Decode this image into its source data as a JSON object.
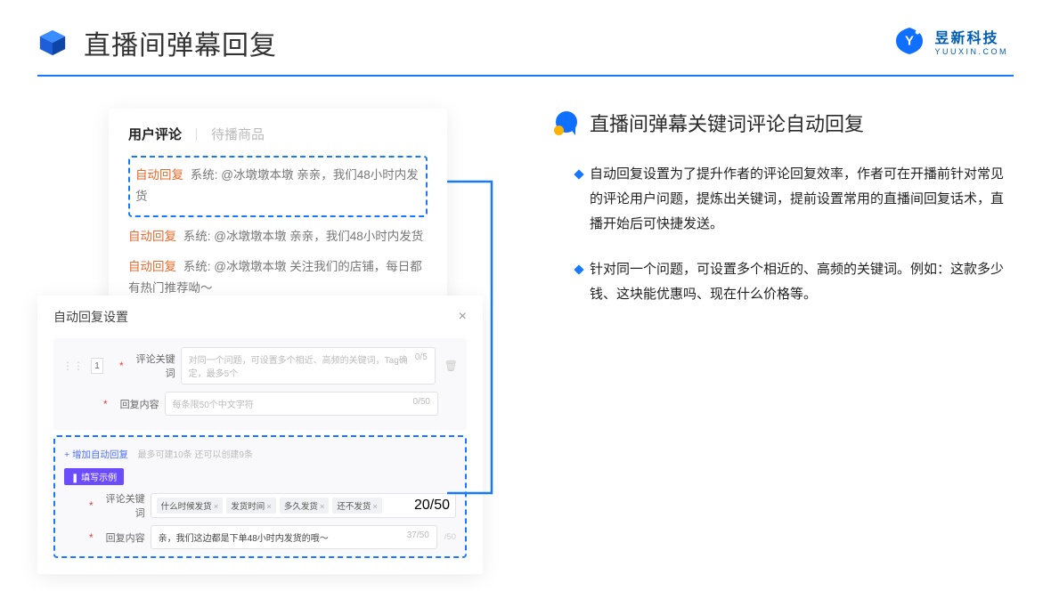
{
  "header": {
    "title": "直播间弹幕回复"
  },
  "brand": {
    "cn": "昱新科技",
    "en": "YUUXIN.COM"
  },
  "right": {
    "section_title": "直播间弹幕关键词评论自动回复",
    "bullets": {
      "b1": "自动回复设置为了提升作者的评论回复效率，作者可在开播前针对常见的评论用户问题，提炼出关键词，提前设置常用的直播间回复话术，直播开始后可快捷发送。",
      "b2": "针对同一个问题，可设置多个相近的、高频的关键词。例如：这款多少钱、这块能优惠吗、现在什么价格等。"
    }
  },
  "comments": {
    "tab_active": "用户评论",
    "tab_inactive": "待播商品",
    "line1_tag": "自动回复",
    "line1_text": "系统: @冰墩墩本墩 亲亲，我们48小时内发货",
    "line2_tag": "自动回复",
    "line2_text": "系统: @冰墩墩本墩 亲亲，我们48小时内发货",
    "line3_tag": "自动回复",
    "line3_text": "系统: @冰墩墩本墩 关注我们的店铺，每日都有热门推荐呦～"
  },
  "dialog": {
    "title": "自动回复设置",
    "num": "1",
    "kw_label": "评论关键词",
    "kw_placeholder": "对同一个问题，可设置多个相近、高频的关键词，Tag确定，最多5个",
    "kw_count": "0/5",
    "reply_label": "回复内容",
    "reply_placeholder": "每条限50个中文字符",
    "reply_count": "0/50",
    "add_link": "+ 增加自动回复",
    "add_note": "最多可建10条 还可以创建9条",
    "pill": "❚ 填写示例",
    "ex_kw_label": "评论关键词",
    "ex_tags": {
      "t1": "什么时候发货",
      "t2": "发货时间",
      "t3": "多久发货",
      "t4": "还不发货"
    },
    "ex_kw_count": "20/50",
    "ex_reply_label": "回复内容",
    "ex_reply_text": "亲，我们这边都是下单48小时内发货的哦～",
    "ex_reply_count": "37/50",
    "side_count": "/50"
  }
}
